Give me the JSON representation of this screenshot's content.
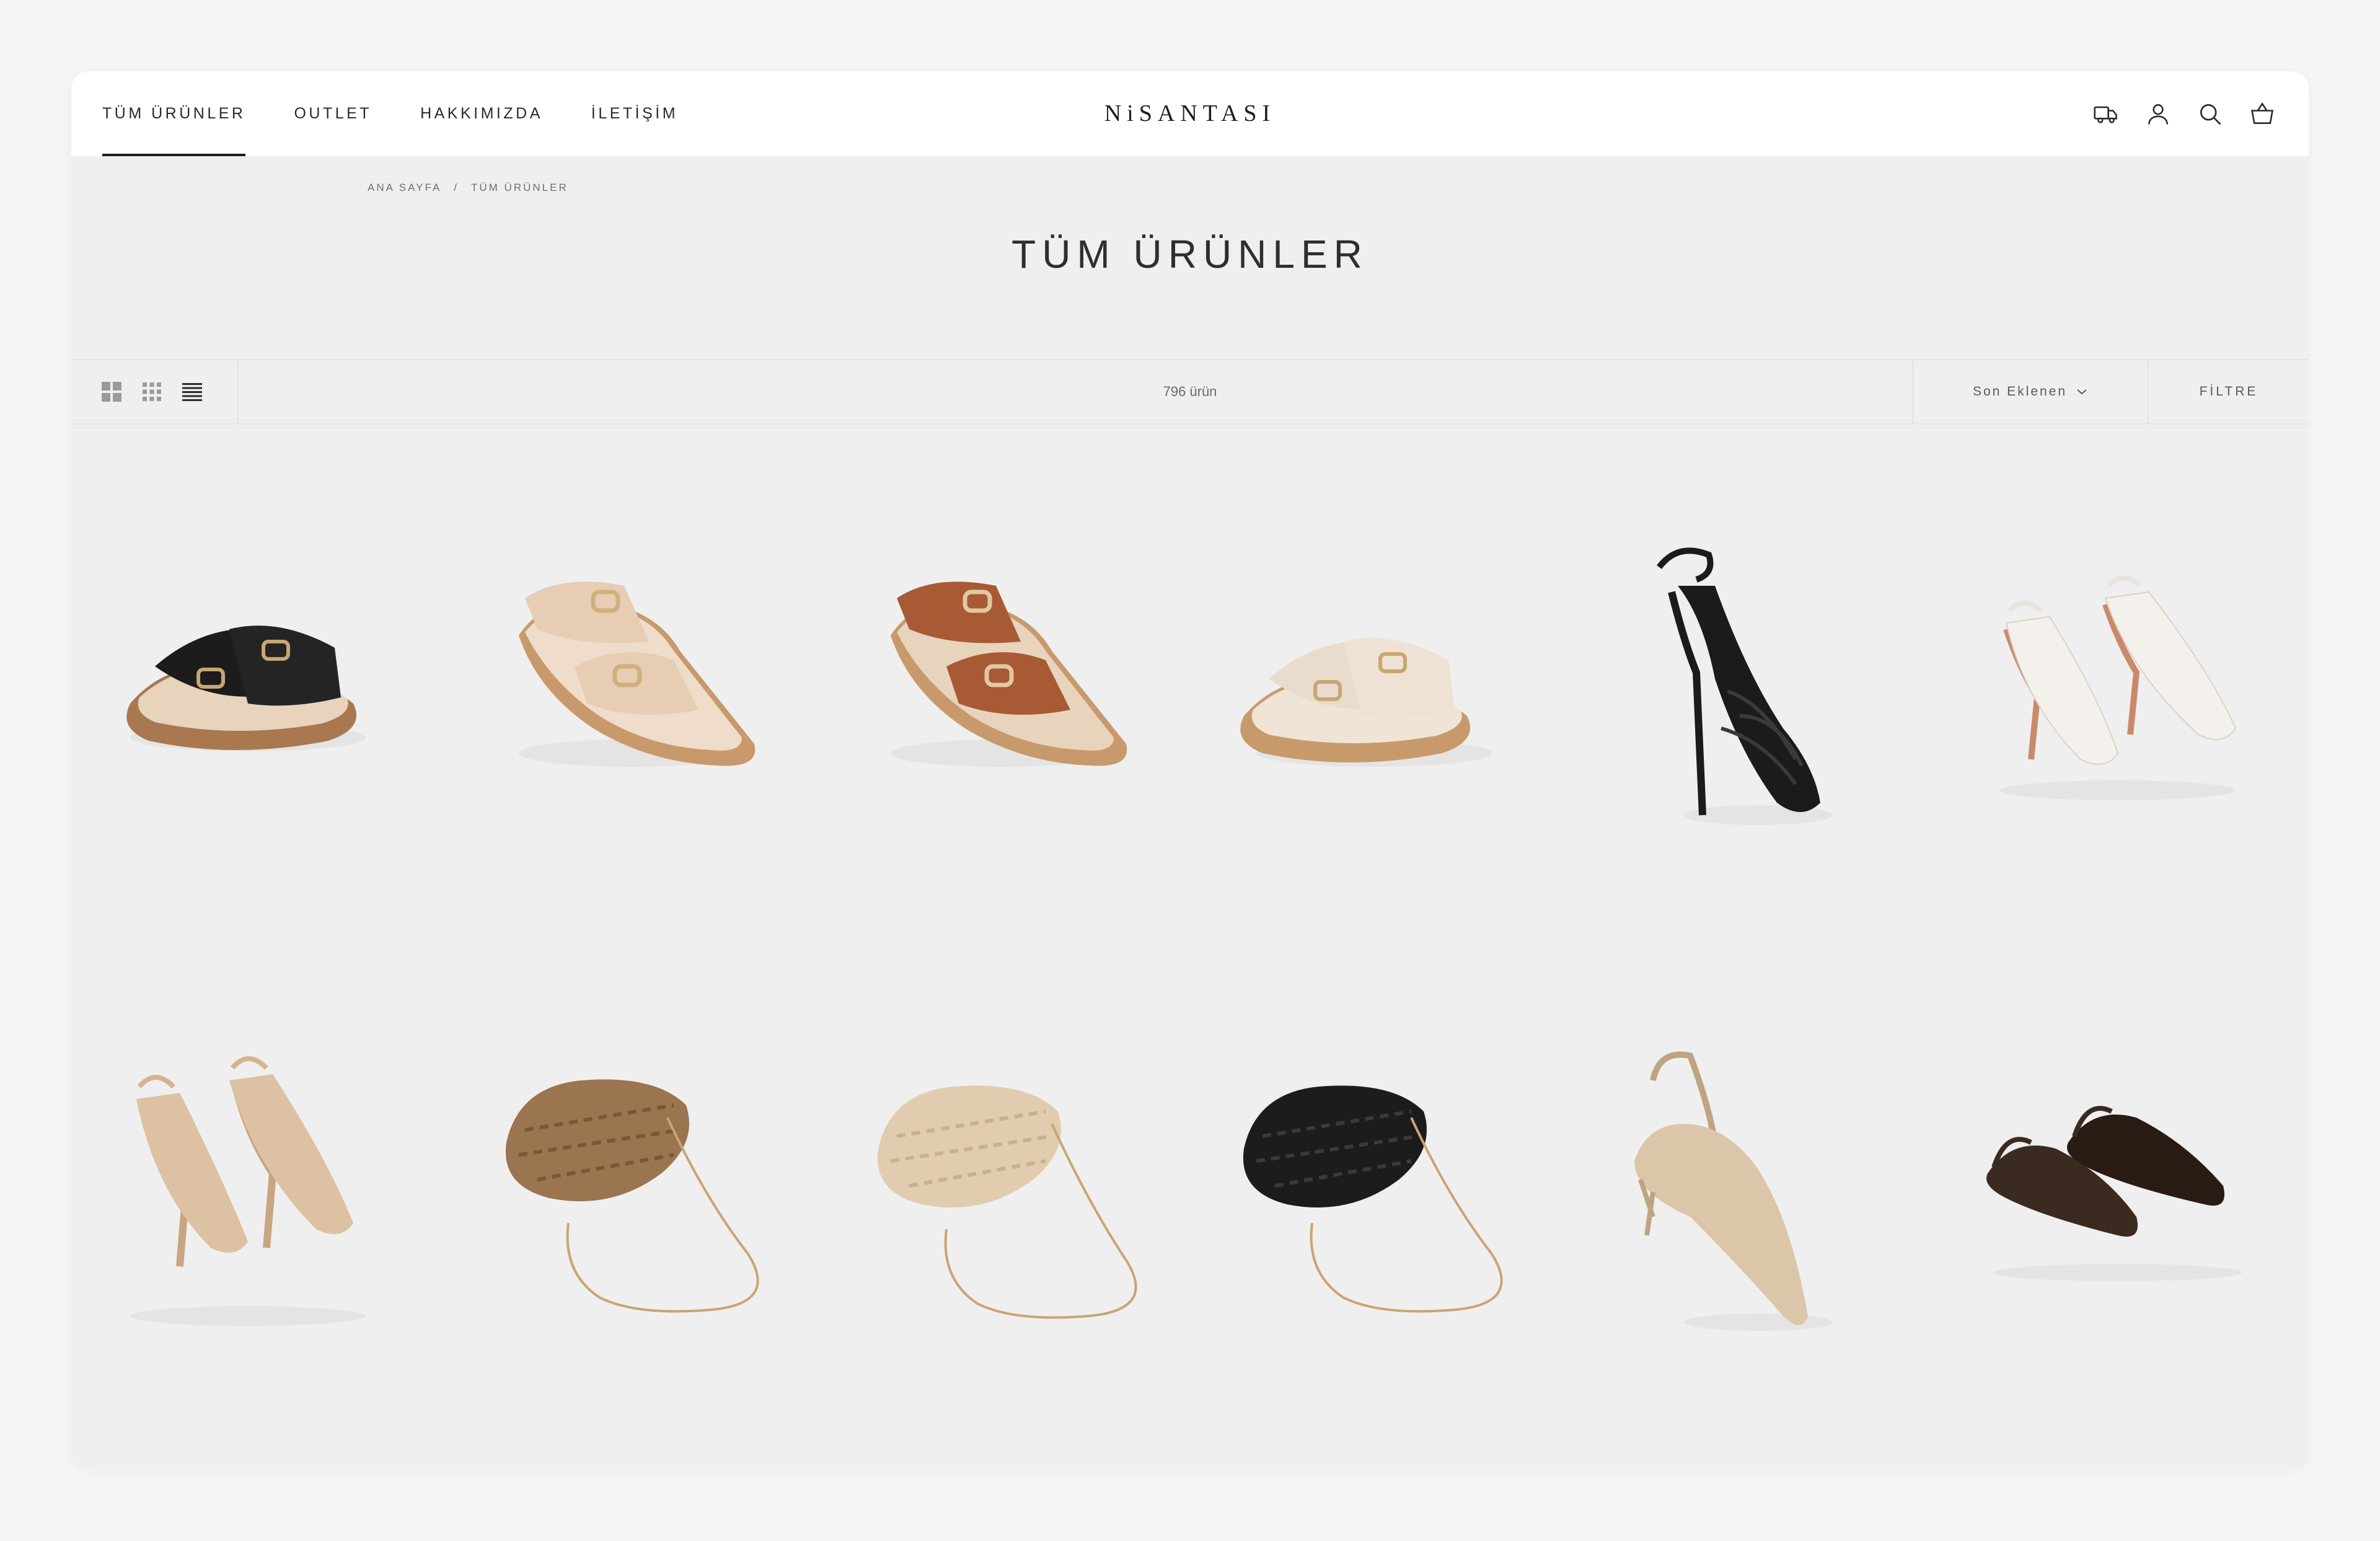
{
  "nav": {
    "items": [
      {
        "label": "TÜM ÜRÜNLER",
        "active": true
      },
      {
        "label": "OUTLET",
        "active": false
      },
      {
        "label": "HAKKIMIZDA",
        "active": false
      },
      {
        "label": "İLETİŞİM",
        "active": false
      }
    ]
  },
  "brand": {
    "logo": "NiSANTASI"
  },
  "header_icons": [
    "delivery-truck-icon",
    "account-icon",
    "search-icon",
    "cart-basket-icon"
  ],
  "breadcrumb": {
    "home": "ANA SAYFA",
    "separator": "/",
    "current": "TÜM ÜRÜNLER"
  },
  "page": {
    "title": "TÜM ÜRÜNLER"
  },
  "toolbar": {
    "layout_icons": [
      "grid-large-icon",
      "grid-small-icon",
      "list-view-icon"
    ],
    "count": "796 ürün",
    "sort_label": "Son Eklenen",
    "filter_label": "FİLTRE"
  },
  "products": [
    {
      "image": "black-buckle-cork-sandal",
      "colors": [
        "#1c1c1c",
        "#b8895a",
        "#e8d3bd"
      ]
    },
    {
      "image": "beige-buckle-cork-sandal",
      "colors": [
        "#e6cdb4",
        "#c89a6b",
        "#efdccb"
      ]
    },
    {
      "image": "tan-buckle-cork-sandal",
      "colors": [
        "#a85a34",
        "#c89a6b",
        "#e8d3bd"
      ]
    },
    {
      "image": "cream-buckle-cork-sandal",
      "colors": [
        "#e9dccd",
        "#c89a6b",
        "#f0e4d6"
      ]
    },
    {
      "image": "black-strappy-heel-sandal",
      "colors": [
        "#1b1b1b"
      ]
    },
    {
      "image": "white-strappy-heel-sandal",
      "colors": [
        "#f4f1ec",
        "#c98a6b"
      ]
    },
    {
      "image": "nude-strappy-heel-sandal",
      "colors": [
        "#dcc1a2",
        "#caa582"
      ]
    },
    {
      "image": "brown-crochet-clutch",
      "colors": [
        "#9b7450",
        "#c9a572"
      ]
    },
    {
      "image": "cream-crochet-clutch",
      "colors": [
        "#e2ccb0",
        "#c9a572"
      ]
    },
    {
      "image": "black-crochet-clutch",
      "colors": [
        "#1c1c1c",
        "#c9a572"
      ]
    },
    {
      "image": "beige-knit-slingback",
      "colors": [
        "#dcc6a9",
        "#bfa483"
      ]
    },
    {
      "image": "brown-knit-slingback",
      "colors": [
        "#3b2a20",
        "#2a1c15"
      ]
    }
  ]
}
